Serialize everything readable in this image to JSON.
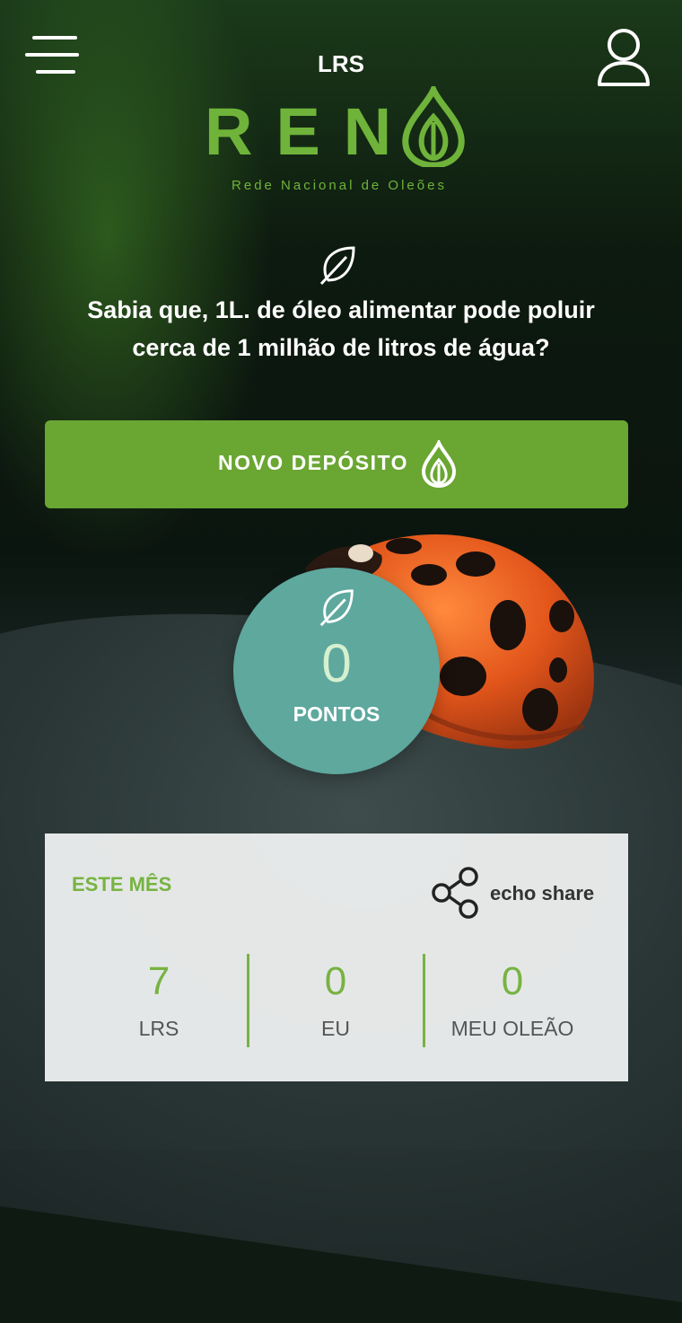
{
  "header": {
    "org_code": "LRS",
    "logo_word": "REN",
    "logo_subtitle": "Rede Nacional de Oleões",
    "menu_icon": "hamburger-menu-icon",
    "user_icon": "user-profile-icon"
  },
  "fact": {
    "icon": "leaf-icon",
    "text": "Sabia que, 1L. de óleo alimentar pode poluir cerca de 1 milhão de litros de água?"
  },
  "cta": {
    "label": "NOVO DEPÓSITO",
    "icon": "oil-drop-icon"
  },
  "points": {
    "value": "0",
    "label": "PONTOS",
    "icon": "leaf-icon"
  },
  "monthly_card": {
    "title": "ESTE MÊS",
    "share_label": "echo share",
    "share_icon": "share-icon",
    "stats": [
      {
        "value": "7",
        "label": "LRS"
      },
      {
        "value": "0",
        "label": "EU"
      },
      {
        "value": "0",
        "label": "MEU OLEÃO"
      }
    ]
  },
  "colors": {
    "brand_green": "#6aa632",
    "points_teal": "#5ea89e",
    "accent_green": "#77b342"
  }
}
